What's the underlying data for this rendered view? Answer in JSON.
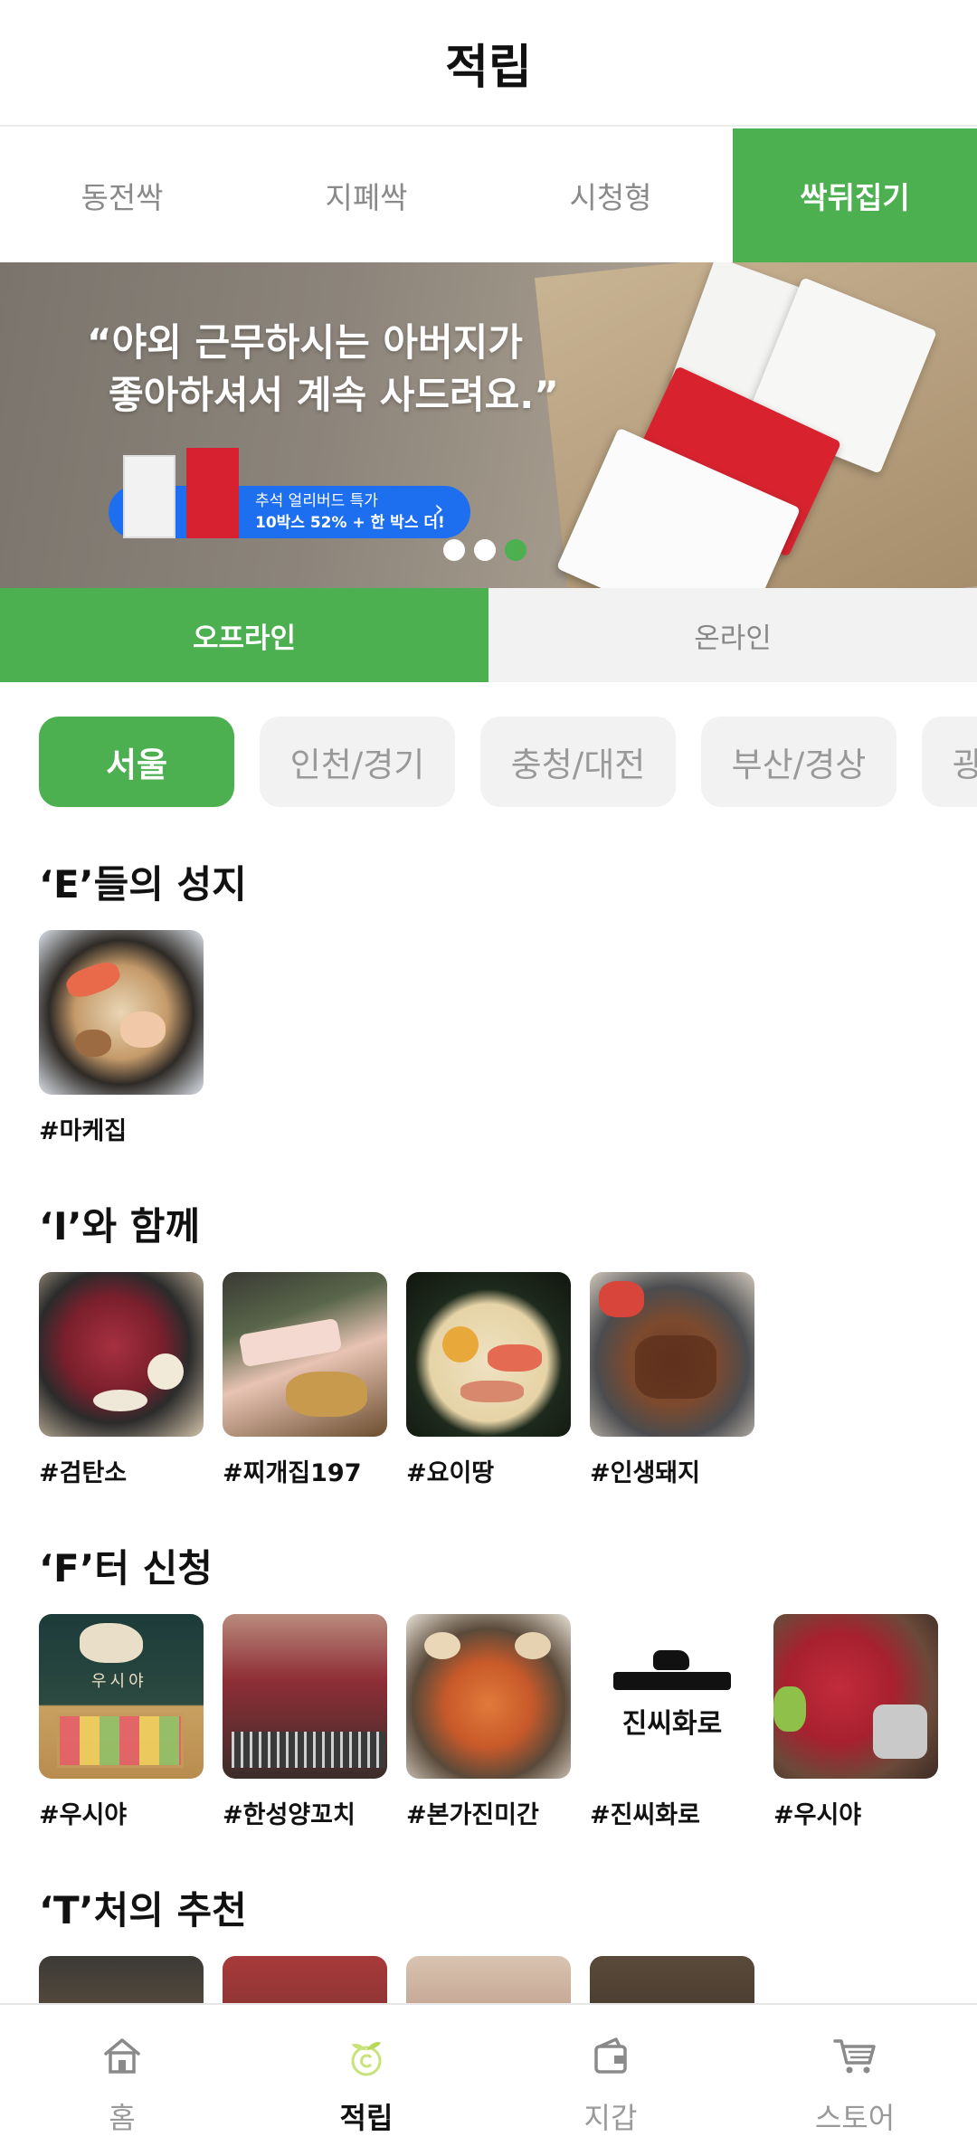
{
  "header": {
    "title": "적립"
  },
  "top_tabs": [
    {
      "label": "동전싹"
    },
    {
      "label": "지폐싹"
    },
    {
      "label": "시청형"
    },
    {
      "label": "싹뒤집기"
    }
  ],
  "banner": {
    "quote_line1": "“야외 근무하시는 아버지가",
    "quote_line2": "좋아하셔서 계속 사드려요.”",
    "promo_line1": "추석 얼리버드 특가",
    "promo_line2": "10박스 52% + 한 박스 더!",
    "promo_chevron": "›",
    "slide_count": 3,
    "active_slide": 3
  },
  "mode_tabs": [
    {
      "label": "오프라인"
    },
    {
      "label": "온라인"
    }
  ],
  "regions": [
    {
      "label": "서울"
    },
    {
      "label": "인천/경기"
    },
    {
      "label": "충청/대전"
    },
    {
      "label": "부산/경상"
    },
    {
      "label": "광주/전라"
    }
  ],
  "sections": [
    {
      "title": "‘E’들의 성지",
      "items": [
        {
          "tag": "#마케집"
        }
      ]
    },
    {
      "title": "‘I’와 함께",
      "items": [
        {
          "tag": "#검탄소"
        },
        {
          "tag": "#찌개집197"
        },
        {
          "tag": "#요이땅"
        },
        {
          "tag": "#인생돼지"
        }
      ]
    },
    {
      "title": "‘F’터 신청",
      "items": [
        {
          "tag": "#우시야"
        },
        {
          "tag": "#한성양꼬치"
        },
        {
          "tag": "#본가진미간"
        },
        {
          "tag": "#진씨화로"
        },
        {
          "tag": "#우시야"
        }
      ]
    },
    {
      "title": "‘T’처의 추천",
      "items": []
    }
  ],
  "thumb_labels": {
    "usiya_sign": "우시야",
    "jinssi_logo": "진씨화로"
  },
  "bottom_nav": [
    {
      "label": "홈",
      "icon": "home-icon"
    },
    {
      "label": "적립",
      "icon": "sprout-coin-icon"
    },
    {
      "label": "지갑",
      "icon": "wallet-icon"
    },
    {
      "label": "스토어",
      "icon": "cart-icon"
    }
  ],
  "colors": {
    "accent": "#4caf50",
    "promo_blue": "#1e6ff0"
  }
}
